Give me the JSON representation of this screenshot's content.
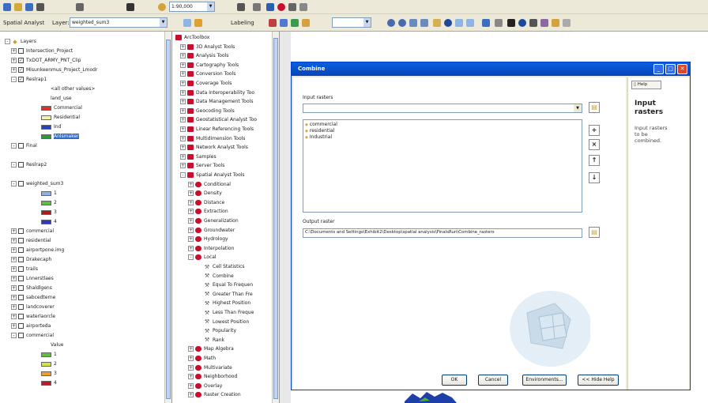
{
  "toolbar": {
    "spatial_analyst": "Spatial Analyst",
    "layer_label": "Layer:",
    "layer_value": "weighted_sum3",
    "labeling": "Labeling",
    "zoom_value": "1:90,000"
  },
  "toc": {
    "rows": [
      {
        "kind": "head",
        "label": "Layers",
        "exp": "-"
      },
      {
        "kind": "layer",
        "label": "Intersection_Project",
        "exp": "+",
        "cb": false
      },
      {
        "kind": "layer",
        "label": "TxDOT_ARMY_PNT_Clip",
        "exp": "+",
        "cb": true
      },
      {
        "kind": "layer",
        "label": "Misunkeenmus_Project_Lmodr",
        "exp": "+",
        "cb": true
      },
      {
        "kind": "layer",
        "label": "Reslrap1",
        "exp": "-",
        "cb": true
      },
      {
        "kind": "sub",
        "label": "<all other values>"
      },
      {
        "kind": "sub",
        "label": "land_use"
      },
      {
        "kind": "swatch",
        "label": "Commercial",
        "color": "#e0302a"
      },
      {
        "kind": "swatch",
        "label": "Residential",
        "color": "#f6f3a6"
      },
      {
        "kind": "swatch",
        "label": "Ind",
        "color": "#2a3fc9"
      },
      {
        "kind": "swatch",
        "label": "Anlsmaker",
        "color": "#2c9a3a",
        "selected": true
      },
      {
        "kind": "layer",
        "label": "Final",
        "exp": "-",
        "cb": false
      },
      {
        "kind": "sub",
        "label": ""
      },
      {
        "kind": "layer",
        "label": "Reslrap2",
        "exp": "-",
        "cb": false
      },
      {
        "kind": "sub",
        "label": ""
      },
      {
        "kind": "layer",
        "label": "weighted_sum3",
        "exp": "-",
        "cb": false
      },
      {
        "kind": "swatch",
        "label": "1",
        "color": "#8ab3e8"
      },
      {
        "kind": "swatch",
        "label": "2",
        "color": "#5fbf3c"
      },
      {
        "kind": "swatch",
        "label": "3",
        "color": "#b01a1a"
      },
      {
        "kind": "swatch",
        "label": "4",
        "color": "#2e36c4"
      },
      {
        "kind": "layer",
        "label": "commercial",
        "exp": "+",
        "cb": false
      },
      {
        "kind": "layer",
        "label": "residential",
        "exp": "+",
        "cb": false
      },
      {
        "kind": "layer",
        "label": "airportpone.img",
        "exp": "+",
        "cb": false
      },
      {
        "kind": "layer",
        "label": "Drakecaph",
        "exp": "+",
        "cb": false
      },
      {
        "kind": "layer",
        "label": "trails",
        "exp": "+",
        "cb": false
      },
      {
        "kind": "layer",
        "label": "Lnnerstlaes",
        "exp": "+",
        "cb": false
      },
      {
        "kind": "layer",
        "label": "Shaldlgens",
        "exp": "+",
        "cb": false
      },
      {
        "kind": "layer",
        "label": "sabcedterne",
        "exp": "+",
        "cb": false
      },
      {
        "kind": "layer",
        "label": "landcoverer",
        "exp": "+",
        "cb": false
      },
      {
        "kind": "layer",
        "label": "waterlaorcle",
        "exp": "+",
        "cb": false
      },
      {
        "kind": "layer",
        "label": "airporteda",
        "exp": "+",
        "cb": false
      },
      {
        "kind": "layer",
        "label": "commercial",
        "exp": "-",
        "cb": false
      },
      {
        "kind": "sub",
        "label": "Value"
      },
      {
        "kind": "swatch",
        "label": "1",
        "color": "#5fbf3c"
      },
      {
        "kind": "swatch",
        "label": "2",
        "color": "#d8e23c"
      },
      {
        "kind": "swatch",
        "label": "3",
        "color": "#f0a020"
      },
      {
        "kind": "swatch",
        "label": "4",
        "color": "#c0182a"
      }
    ]
  },
  "toolbox": {
    "rows": [
      {
        "kind": "root",
        "label": "ArcToolbox"
      },
      {
        "kind": "box",
        "label": "3D Analyst Tools"
      },
      {
        "kind": "box",
        "label": "Analysis Tools"
      },
      {
        "kind": "box",
        "label": "Cartography Tools"
      },
      {
        "kind": "box",
        "label": "Conversion Tools"
      },
      {
        "kind": "box",
        "label": "Coverage Tools"
      },
      {
        "kind": "box",
        "label": "Data Interoperability Too"
      },
      {
        "kind": "box",
        "label": "Data Management Tools"
      },
      {
        "kind": "box",
        "label": "Geocoding Tools"
      },
      {
        "kind": "box",
        "label": "Geostatistical Analyst Too"
      },
      {
        "kind": "box",
        "label": "Linear Referencing Tools"
      },
      {
        "kind": "box",
        "label": "Multidimension Tools"
      },
      {
        "kind": "box",
        "label": "Network Analyst Tools"
      },
      {
        "kind": "box",
        "label": "Samples"
      },
      {
        "kind": "box",
        "label": "Server Tools"
      },
      {
        "kind": "boxopen",
        "label": "Spatial Analyst Tools"
      },
      {
        "kind": "set",
        "label": "Conditional"
      },
      {
        "kind": "set",
        "label": "Density"
      },
      {
        "kind": "set",
        "label": "Distance"
      },
      {
        "kind": "set",
        "label": "Extraction"
      },
      {
        "kind": "set",
        "label": "Generalization"
      },
      {
        "kind": "set",
        "label": "Groundwater"
      },
      {
        "kind": "set",
        "label": "Hydrology"
      },
      {
        "kind": "set",
        "label": "Interpolation"
      },
      {
        "kind": "setopen",
        "label": "Local"
      },
      {
        "kind": "tool",
        "label": "Cell Statistics"
      },
      {
        "kind": "tool",
        "label": "Combine"
      },
      {
        "kind": "tool",
        "label": "Equal To Frequen"
      },
      {
        "kind": "tool",
        "label": "Greater Than Fre"
      },
      {
        "kind": "tool",
        "label": "Highest Position"
      },
      {
        "kind": "tool",
        "label": "Less Than Freque"
      },
      {
        "kind": "tool",
        "label": "Lowest Position"
      },
      {
        "kind": "tool",
        "label": "Popularity"
      },
      {
        "kind": "tool",
        "label": "Rank"
      },
      {
        "kind": "set",
        "label": "Map Algebra"
      },
      {
        "kind": "set",
        "label": "Math"
      },
      {
        "kind": "set",
        "label": "Multivariate"
      },
      {
        "kind": "set",
        "label": "Neighborhood"
      },
      {
        "kind": "set",
        "label": "Overlay"
      },
      {
        "kind": "set",
        "label": "Raster Creation"
      }
    ]
  },
  "dialog": {
    "title": "Combine",
    "input_label": "Input rasters",
    "input_value": "",
    "list": [
      "commercial",
      "residential",
      "Industrial"
    ],
    "output_label": "Output raster",
    "output_value": "C:\\Documents and Settings\\Exhibit2\\Desktop\\spatial analysis\\FinalsRun\\Combine_rasters",
    "buttons": {
      "ok": "OK",
      "cancel": "Cancel",
      "env": "Environments...",
      "help": "<< Hide Help"
    }
  },
  "help": {
    "tab": "Help",
    "heading": "Input rasters",
    "desc": "Input rasters to be combined."
  }
}
